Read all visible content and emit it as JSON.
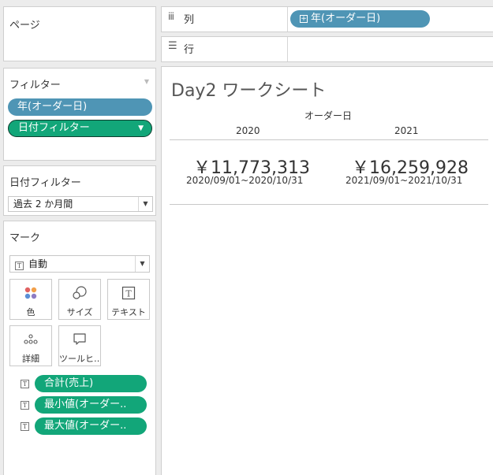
{
  "pages": {
    "title": "ページ"
  },
  "filters": {
    "title": "フィルター",
    "pills": [
      {
        "label": "年(オーダー日)"
      },
      {
        "label": "日付フィルター"
      }
    ]
  },
  "date_filter": {
    "title": "日付フィルター",
    "selected": "過去 2 か月間"
  },
  "marks": {
    "title": "マーク",
    "type_selected": "自動",
    "buttons": [
      {
        "label": "色",
        "icon": "color-dots-icon"
      },
      {
        "label": "サイズ",
        "icon": "size-icon"
      },
      {
        "label": "テキスト",
        "icon": "text-icon"
      },
      {
        "label": "詳細",
        "icon": "detail-icon"
      },
      {
        "label": "ツールヒ…",
        "icon": "tooltip-icon"
      }
    ],
    "fields": [
      {
        "label": "合計(売上)"
      },
      {
        "label": "最小値(オーダー.."
      },
      {
        "label": "最大値(オーダー.."
      }
    ]
  },
  "shelves": {
    "columns": {
      "label": "列",
      "pill": "年(オーダー日)"
    },
    "rows": {
      "label": "行"
    }
  },
  "worksheet": {
    "title": "Day2 ワークシート",
    "header": "オーダー日",
    "columns": [
      {
        "year": "2020",
        "value": "￥11,773,313",
        "range": "2020/09/01~2020/10/31"
      },
      {
        "year": "2021",
        "value": "￥16,259,928",
        "range": "2021/09/01~2021/10/31"
      }
    ]
  },
  "colors": {
    "blue_pill": "#4f95b5",
    "green_pill": "#12a679"
  }
}
